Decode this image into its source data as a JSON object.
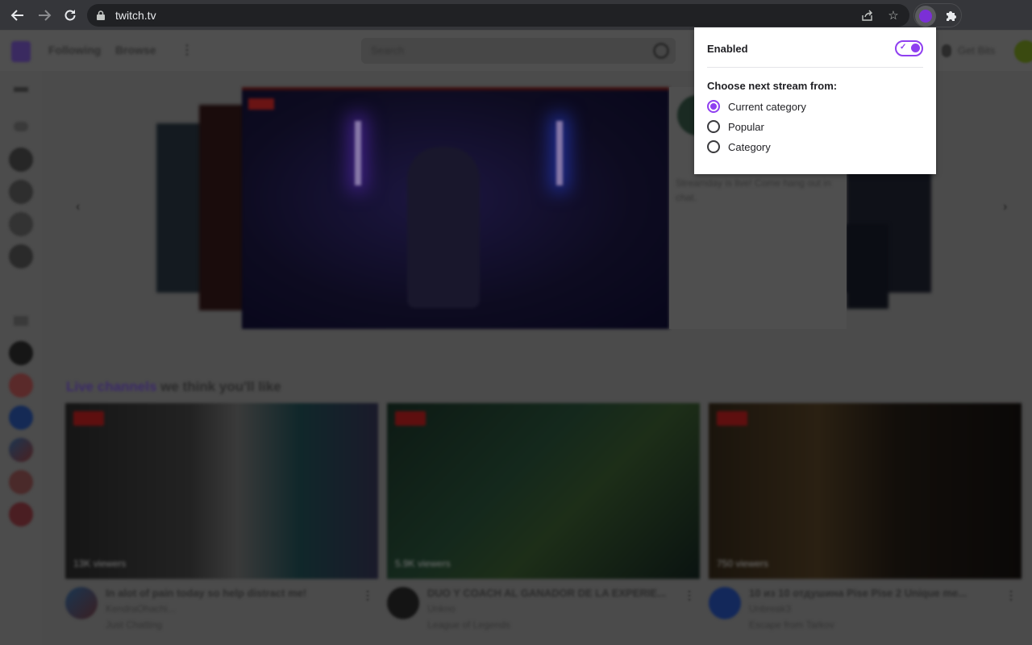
{
  "browser": {
    "url": "twitch.tv",
    "back_icon": "arrow-left-icon",
    "forward_icon": "arrow-right-icon",
    "reload_icon": "reload-icon",
    "share_icon": "share-icon",
    "bookmark_icon": "star-icon",
    "extension_icon": "auto-next-stream-extension-icon",
    "extensions_menu_icon": "puzzle-icon"
  },
  "twitch": {
    "nav": {
      "following": "Following",
      "browse": "Browse",
      "search_placeholder": "Search",
      "get_bits": "Get Bits"
    },
    "hero": {
      "description": "Streamday is live! Come hang out in chat."
    },
    "section": {
      "title_highlight": "Live channels",
      "title_rest": " we think you'll like"
    },
    "cards": [
      {
        "live": "LIVE",
        "viewers": "13K viewers",
        "title": "In alot of pain today so help distract me!",
        "channel": "KendraOhachi...",
        "category": "Just Chatting"
      },
      {
        "live": "LIVE",
        "viewers": "5.9K viewers",
        "title": "DUO Y COACH AL GANADOR DE LA EXPERIE...",
        "channel": "Unkno",
        "category": "League of Legends"
      },
      {
        "live": "LIVE",
        "viewers": "750 viewers",
        "title": "10 из 10 отдушина Pise Pise 2 Unique me...",
        "channel": "Unbreak3",
        "category": "Escape from Tarkov"
      }
    ]
  },
  "popup": {
    "enabled_label": "Enabled",
    "enabled": true,
    "choose_label": "Choose next stream from:",
    "options": [
      {
        "label": "Current category",
        "checked": true
      },
      {
        "label": "Popular",
        "checked": false
      },
      {
        "label": "Category",
        "checked": false
      }
    ],
    "accent_color": "#8f3ff0"
  }
}
